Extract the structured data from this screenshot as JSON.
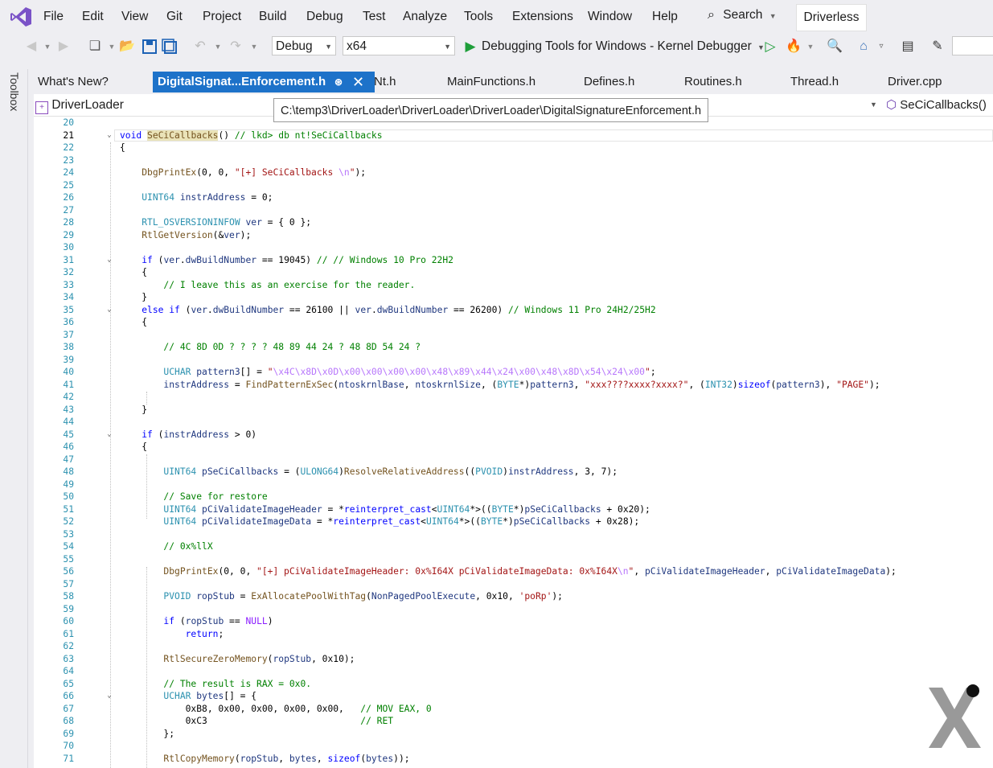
{
  "menubar": {
    "items": [
      "File",
      "Edit",
      "View",
      "Git",
      "Project",
      "Build",
      "Debug",
      "Test",
      "Analyze",
      "Tools",
      "Extensions",
      "Window",
      "Help"
    ],
    "search_label": "Search",
    "solution_name": "Driverless"
  },
  "toolbar": {
    "configuration": "Debug",
    "platform": "x64",
    "debug_target": "Debugging Tools for Windows - Kernel Debugger"
  },
  "toolbox": {
    "label": "Toolbox"
  },
  "tabs": [
    {
      "label": "What's New?"
    },
    {
      "label": "DigitalSignat...Enforcement.h",
      "active": true
    },
    {
      "label": "Nt.h"
    },
    {
      "label": "MainFunctions.h"
    },
    {
      "label": "Defines.h"
    },
    {
      "label": "Routines.h"
    },
    {
      "label": "Thread.h"
    },
    {
      "label": "Driver.cpp"
    }
  ],
  "navbar": {
    "project": "DriverLoader",
    "member": "SeCiCallbacks()"
  },
  "tooltip": {
    "path": "C:\\temp3\\DriverLoader\\DriverLoader\\DriverLoader\\DigitalSignatureEnforcement.h"
  },
  "editor": {
    "current_line": 21,
    "line_numbers": [
      20,
      21,
      22,
      23,
      24,
      25,
      26,
      27,
      28,
      29,
      30,
      31,
      32,
      33,
      34,
      35,
      36,
      37,
      38,
      39,
      40,
      41,
      42,
      43,
      44,
      45,
      46,
      47,
      48,
      49,
      50,
      51,
      52,
      53,
      54,
      55,
      56,
      57,
      58,
      59,
      60,
      61,
      62,
      63,
      64,
      65,
      66,
      67,
      68,
      69,
      70,
      71
    ]
  },
  "colors": {
    "accent": "#1d72c9",
    "keyword": "#0000ff",
    "type": "#2b91af",
    "function": "#74531f",
    "string": "#a31515",
    "comment": "#008000",
    "line_number": "#2b91af"
  }
}
